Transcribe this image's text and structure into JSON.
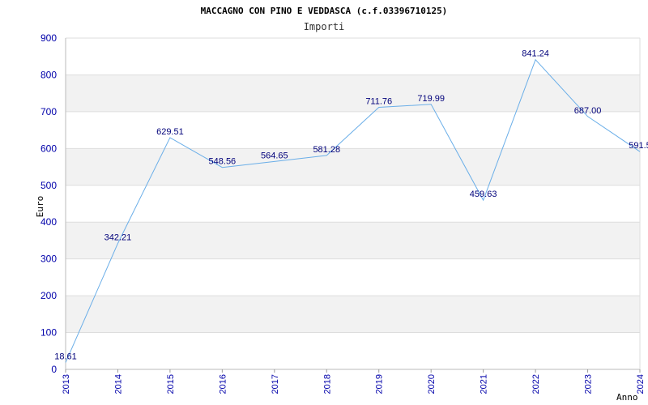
{
  "chart_data": {
    "type": "line",
    "title": "MACCAGNO CON PINO E VEDDASCA (c.f.03396710125)",
    "subtitle": "Importi",
    "xlabel": "Anno",
    "ylabel": "Euro",
    "ylim": [
      0,
      900
    ],
    "yticks": [
      0,
      100,
      200,
      300,
      400,
      500,
      600,
      700,
      800,
      900
    ],
    "x": [
      "2013",
      "2014",
      "2015",
      "2016",
      "2017",
      "2018",
      "2019",
      "2020",
      "2021",
      "2022",
      "2023",
      "2024"
    ],
    "series": [
      {
        "values": [
          18.61,
          342.21,
          629.51,
          548.56,
          564.65,
          581.28,
          711.76,
          719.99,
          459.63,
          841.24,
          687.0,
          591.5
        ],
        "labels": [
          "18.61",
          "342.21",
          "629.51",
          "548.56",
          "564.65",
          "581.28",
          "711.76",
          "719.99",
          "459.63",
          "841.24",
          "687.00",
          "591.5"
        ]
      }
    ],
    "grid": true,
    "legend": "none",
    "colors": {
      "line": "#6aaee8",
      "band": "#f2f2f2",
      "grid": "#dddddd",
      "tick_text": "#0000aa",
      "data_text": "#00007a"
    }
  }
}
